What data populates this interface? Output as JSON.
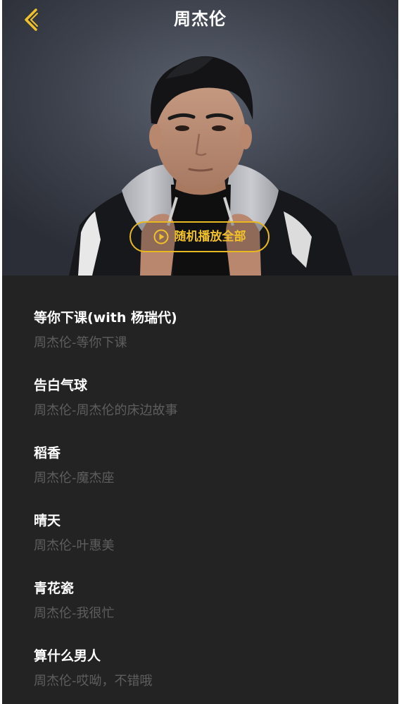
{
  "header": {
    "title": "周杰伦",
    "back_icon": "chevron-left-icon"
  },
  "hero": {
    "image": "artist-photo",
    "play_all_label": "随机播放全部",
    "play_icon": "play-circle-icon"
  },
  "colors": {
    "accent": "#f1c12a",
    "background": "#232323",
    "title_text": "#ffffff",
    "subtitle_text": "#5e5e5e"
  },
  "songs": [
    {
      "title": "等你下课(with 杨瑞代)",
      "subtitle": "周杰伦-等你下课"
    },
    {
      "title": "告白气球",
      "subtitle": "周杰伦-周杰伦的床边故事"
    },
    {
      "title": "稻香",
      "subtitle": "周杰伦-魔杰座"
    },
    {
      "title": "晴天",
      "subtitle": "周杰伦-叶惠美"
    },
    {
      "title": "青花瓷",
      "subtitle": "周杰伦-我很忙"
    },
    {
      "title": "算什么男人",
      "subtitle": "周杰伦-哎呦，不错哦"
    }
  ]
}
